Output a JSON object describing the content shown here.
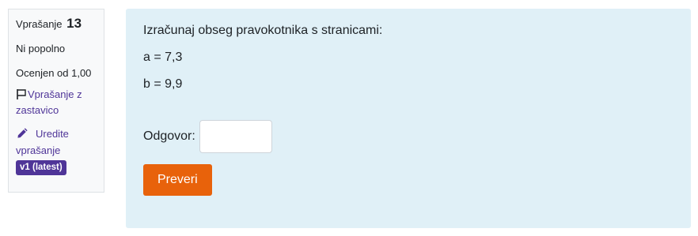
{
  "info": {
    "question_label": "Vprašanje",
    "question_number": "13",
    "state": "Ni popolno",
    "grade": "Ocenjen od 1,00",
    "flag_label": "Vprašanje z zastavico",
    "edit_label": "Uredite vprašanje",
    "version_badge": "v1 (latest)",
    "link_color": "#4f3598"
  },
  "content": {
    "question_text": "Izračunaj obseg pravokotnika s stranicami:",
    "side_a": "a = 7,3",
    "side_b": "b = 9,9",
    "answer_label": "Odgovor:",
    "answer_value": "",
    "check_button": "Preveri",
    "background": "#e0f0f7",
    "button_color": "#e8620b"
  }
}
